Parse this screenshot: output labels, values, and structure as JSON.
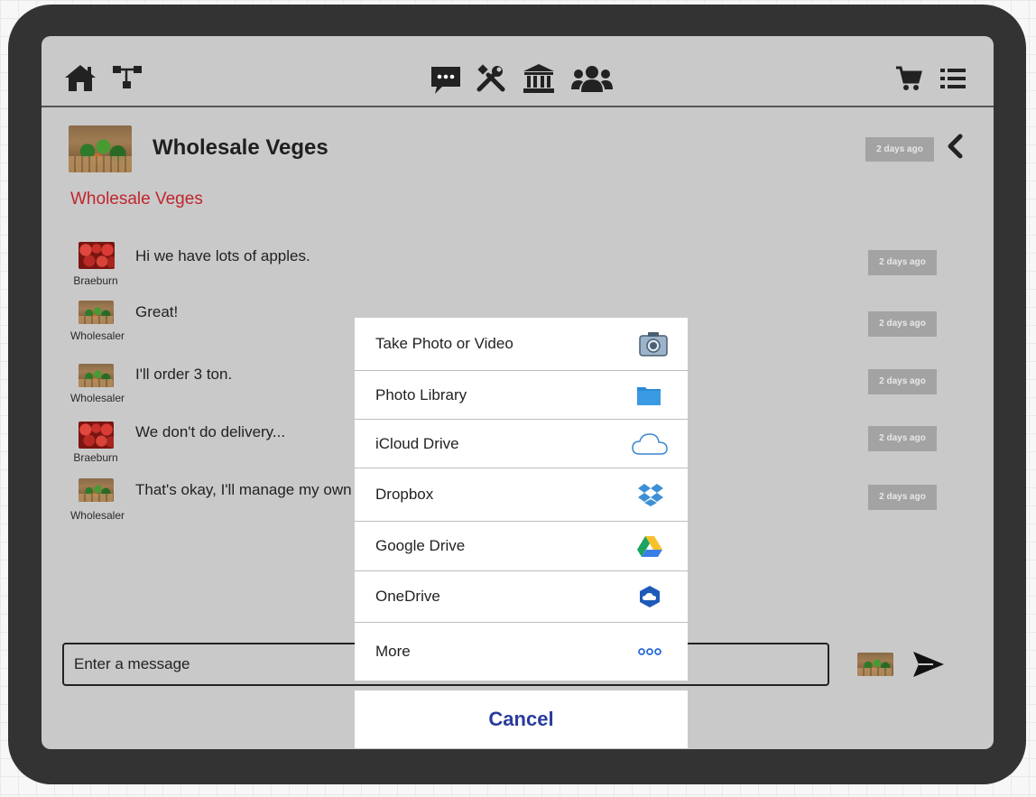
{
  "nav": {
    "home_icon": "home-icon",
    "sitemap_icon": "sitemap-icon",
    "chat_icon": "chat-icon",
    "tools_icon": "tools-icon",
    "institution_icon": "institution-icon",
    "users_icon": "users-icon",
    "cart_icon": "cart-icon",
    "list_icon": "list-icon"
  },
  "chat": {
    "title": "Wholesale Veges",
    "header_time": "2 days ago",
    "subtitle": "Wholesale Veges",
    "subtitle_color": "#c0262d"
  },
  "messages": [
    {
      "sender": "Braeburn",
      "text": "Hi we have lots of apples.",
      "time": "2 days ago"
    },
    {
      "sender": "Wholesaler",
      "text": "Great!",
      "time": "2 days ago"
    },
    {
      "sender": "Wholesaler",
      "text": "I'll order 3 ton.",
      "time": "2 days ago"
    },
    {
      "sender": "Braeburn",
      "text": "We don't do delivery...",
      "time": "2 days ago"
    },
    {
      "sender": "Wholesaler",
      "text": "That's okay, I'll manage my own c",
      "time": "2 days ago"
    }
  ],
  "composer": {
    "placeholder": "Enter a message"
  },
  "share_sheet": {
    "items": [
      {
        "label": "Take Photo or Video",
        "icon": "camera-icon"
      },
      {
        "label": "Photo Library",
        "icon": "folder-icon"
      },
      {
        "label": "iCloud Drive",
        "icon": "cloud-icon"
      },
      {
        "label": "Dropbox",
        "icon": "dropbox-icon"
      },
      {
        "label": "Google Drive",
        "icon": "google-drive-icon"
      },
      {
        "label": "OneDrive",
        "icon": "onedrive-icon"
      },
      {
        "label": "More",
        "icon": "more-icon"
      }
    ],
    "cancel_label": "Cancel",
    "cancel_color": "#2a3c9c"
  }
}
